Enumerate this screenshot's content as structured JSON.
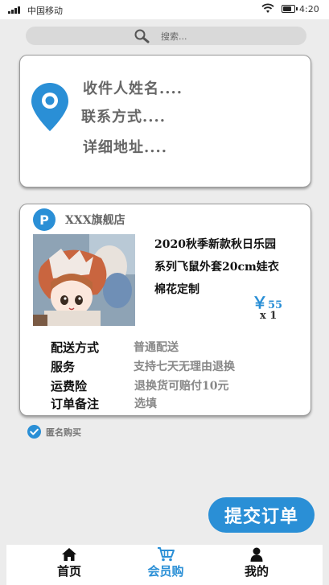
{
  "status_bar": {
    "carrier": "中国移动",
    "time": "4:20",
    "battery_level": 0.85
  },
  "search": {
    "placeholder": "搜索..."
  },
  "address": {
    "name": "收件人姓名....",
    "contact": "联系方式....",
    "detail": "详细地址...."
  },
  "order": {
    "shop_badge": "P",
    "shop_name": "XXX旗舰店",
    "product_title_lines": [
      "2020秋季新款秋日乐园",
      "系列飞鼠外套20cm娃衣",
      "棉花定制"
    ],
    "price_symbol": "￥",
    "price": "55",
    "quantity": "x 1",
    "details": [
      {
        "label": "配送方式",
        "value": "普通配送"
      },
      {
        "label": "服务",
        "value": "支持七天无理由退换"
      },
      {
        "label": "运费险",
        "value": "退换货可赔付10元"
      },
      {
        "label": "订单备注",
        "value": "选填"
      }
    ]
  },
  "anonymous": {
    "label": "匿名购买",
    "checked": true
  },
  "submit": {
    "label": "提交订单"
  },
  "nav": [
    {
      "label": "首页",
      "icon": "home-icon",
      "active": false
    },
    {
      "label": "会员购",
      "icon": "cart-icon",
      "active": true
    },
    {
      "label": "我的",
      "icon": "user-icon",
      "active": false
    }
  ],
  "colors": {
    "accent": "#2a8fd6",
    "background": "#ececec",
    "card": "#ffffff"
  }
}
